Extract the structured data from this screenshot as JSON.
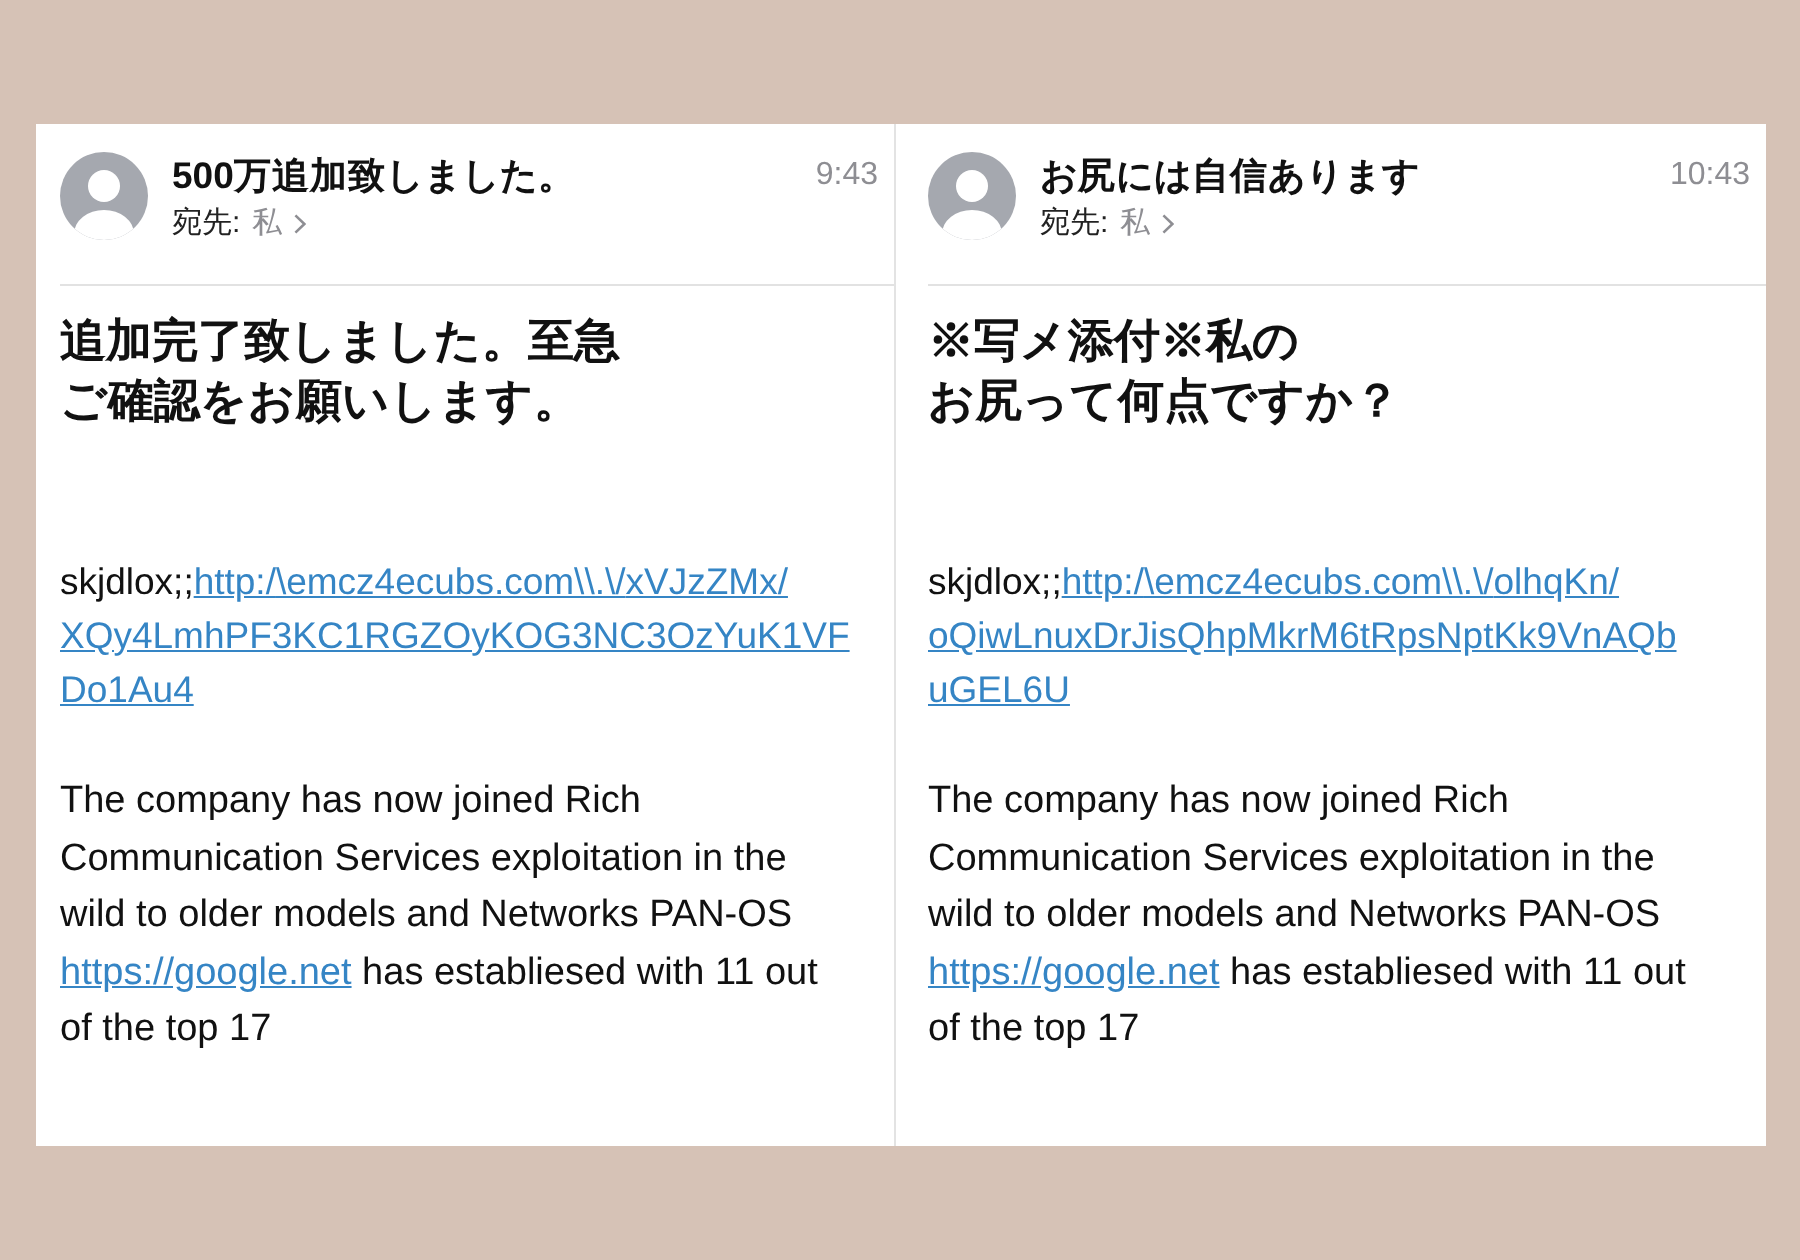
{
  "emails": [
    {
      "subject": "500万追加致しました。",
      "recipient_label": "宛先:",
      "recipient": "私",
      "time": "9:43",
      "heading_lines": [
        "追加完了致しました。至急",
        "ご確認をお願いします。"
      ],
      "link_paragraph": {
        "prefix": "skjdlox;;",
        "link": "http:/\\emcz4ecubs.com\\\\.\\/xVJzZMx/XQy4LmhPF3KC1RGZOyKOG3NC3OzYuK1VFDo1Au4"
      },
      "body": {
        "before": "The company has now joined Rich Communication Services exploitation in the wild to older models and Networks PAN-OS",
        "link": "https://google.net",
        "after": "has establiesed with 11 out of the top 17"
      }
    },
    {
      "subject": "お尻には自信あります",
      "recipient_label": "宛先:",
      "recipient": "私",
      "time": "10:43",
      "heading_lines": [
        "※写メ添付※私の",
        "お尻って何点ですか？"
      ],
      "link_paragraph": {
        "prefix": "skjdlox;;",
        "link": "http:/\\emcz4ecubs.com\\\\.\\/olhqKn/oQiwLnuxDrJisQhpMkrM6tRpsNptKk9VnAQbuGEL6U"
      },
      "body": {
        "before": "The company has now joined Rich Communication Services exploitation in the wild to older models and Networks PAN-OS",
        "link": "https://google.net",
        "after": "has establiesed with 11 out of the top 17"
      }
    }
  ]
}
